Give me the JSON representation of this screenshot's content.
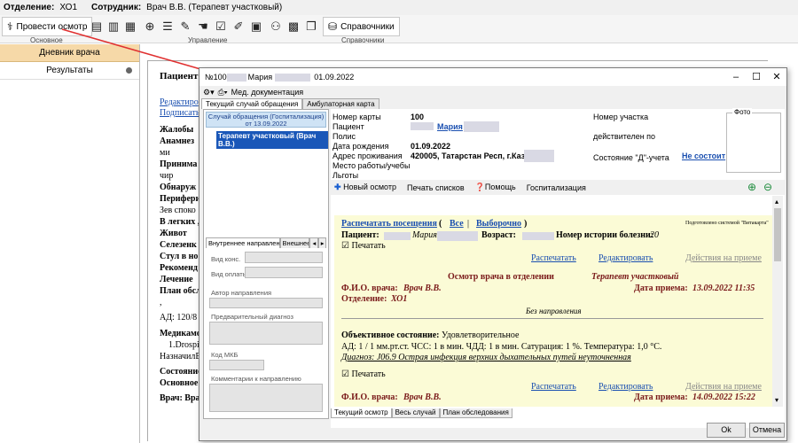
{
  "topbar": {
    "dept_label": "Отделение:",
    "dept_value": "ХО1",
    "staff_label": "Сотрудник:",
    "staff_value": "Врач В.В. (Терапевт участковый)"
  },
  "ribbon": {
    "exam_button": "Провести осмотр",
    "directories_button": "Справочники",
    "group_main": "Основное",
    "group_control": "Управление",
    "group_directories": "Справочники"
  },
  "sidebar": {
    "title": "Дневник врача",
    "item_results": "Результаты"
  },
  "bgdoc": {
    "patient_label": "Пациент: Т",
    "lines": [
      "Редактиро",
      "Подписать",
      "Жалобы",
      "Анамнез",
      "ми",
      "Принима",
      "чир",
      "Обнаруж",
      "Перифери",
      "Зев споко",
      "В легких ,",
      "Живот",
      "Селезенк",
      "Стул в но",
      "Рекоменд",
      "Лечение",
      "План обсл",
      ",",
      "АД: 120/8",
      "Медикамо",
      "1.Drospir",
      "НазначилВ",
      "Состояние",
      "Основное",
      "Врач: Вра"
    ]
  },
  "modal": {
    "title_prefix": "№100",
    "title_name": "Мария",
    "title_date": "01.09.2022",
    "toolbar_label": "Мед. документация",
    "tabs": [
      "Текущий случай обращения",
      "Амбулаторная карта"
    ],
    "tree_head": "Случай обращения (Госпитализация) от 13.09.2022",
    "tree_item": "Терапевт участковый (Врач В.В.)",
    "ref_tabs": [
      "Внутреннее направление",
      "Внешнее на"
    ],
    "ref_fields": {
      "cons_type": "Вид конс.",
      "payment_type": "Вид оплаты",
      "author": "Автор направления",
      "diagnosis": "Предварительный диагноз",
      "mkb": "Код МКБ",
      "comments": "Комментарии к направлению"
    },
    "patient": {
      "card_label": "Номер карты",
      "card_value": "100",
      "patient_label": "Пациент",
      "patient_value": "Мария",
      "policy_label": "Полис",
      "birth_label": "Дата рождения",
      "birth_value": "01.09.2022",
      "address_label": "Адрес проживания",
      "address_value": "420005, Татарстан Респ, г.Каза",
      "work_label": "Место работы/учебы",
      "benefits_label": "Льготы",
      "district_label": "Номер участка",
      "valid_label": "действителен по",
      "d_state_label": "Состояние \"Д\"-учета",
      "d_state_value": "Не состоит",
      "photo_label": "Фото"
    },
    "actions": {
      "new_exam": "Новый осмотр",
      "print_lists": "Печать списков",
      "help": "Помощь",
      "hospitalization": "Госпитализация"
    },
    "report": {
      "print_visits": "Распечатать посещения",
      "all": "Все",
      "selected": "Выборочно",
      "system_note": "Подготовлено системой \"Витакарта\"",
      "patient_label": "Пациент:",
      "patient_name": "Мария",
      "age_label": "Возраст:",
      "history_label": "Номер истории болезни:",
      "history_value": "20",
      "print_check": "Печатать",
      "print_link": "Распечатать",
      "edit_link": "Редактировать",
      "actions_link": "Действия на приеме",
      "exam_title": "Осмотр врача в отделении",
      "exam_specialty": "Терапевт участковый",
      "doctor_label": "Ф.И.О. врача:",
      "doctor_value": "Врач В.В.",
      "date_label": "Дата приема:",
      "date_value": "13.09.2022 11:35",
      "dept_label": "Отделение:",
      "dept_value": "ХО1",
      "no_referral": "Без направления",
      "objective_label": "Объективное состояние:",
      "objective_value": "Удовлетворительное",
      "vitals_line": "АД: 1 / 1 мм.рт.ст. ЧСС: 1 в мин. ЧДД: 1 в мин. Сатурация: 1 %. Температура: 1,0 °С.",
      "diagnosis_line": "Диагноз: J06.9 Острая инфекция верхних дыхательных путей неуточненная",
      "print_check2": "Печатать",
      "print_link2": "Распечатать",
      "edit_link2": "Редактировать",
      "actions_link2": "Действия на приеме",
      "doctor_value2": "Врач В.В.",
      "date_value2": "14.09.2022 15:22"
    },
    "bottom_tabs": [
      "Текущий осмотр",
      "Весь случай",
      "План обследования"
    ],
    "ok": "Ok",
    "cancel": "Отмена"
  }
}
